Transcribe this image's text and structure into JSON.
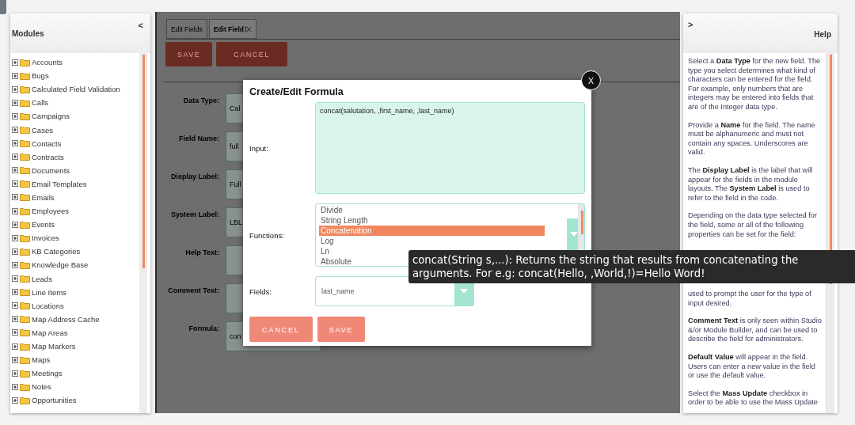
{
  "modules_panel": {
    "title": "Modules",
    "toggle": "<",
    "items": [
      {
        "label": "Accounts",
        "expanded": false
      },
      {
        "label": "Bugs",
        "expanded": false
      },
      {
        "label": "Calculated Field Validation",
        "expanded": false
      },
      {
        "label": "Calls",
        "expanded": false
      },
      {
        "label": "Campaigns",
        "expanded": false
      },
      {
        "label": "Cases",
        "expanded": false
      },
      {
        "label": "Contacts",
        "expanded": false
      },
      {
        "label": "Contracts",
        "expanded": false
      },
      {
        "label": "Documents",
        "expanded": false
      },
      {
        "label": "Email Templates",
        "expanded": false
      },
      {
        "label": "Emails",
        "expanded": false
      },
      {
        "label": "Employees",
        "expanded": false
      },
      {
        "label": "Events",
        "expanded": false
      },
      {
        "label": "Invoices",
        "expanded": false
      },
      {
        "label": "KB Categories",
        "expanded": false
      },
      {
        "label": "Knowledge Base",
        "expanded": false
      },
      {
        "label": "Leads",
        "expanded": false
      },
      {
        "label": "Line Items",
        "expanded": false
      },
      {
        "label": "Locations",
        "expanded": false
      },
      {
        "label": "Map Address Cache",
        "expanded": false
      },
      {
        "label": "Map Areas",
        "expanded": false
      },
      {
        "label": "Map Markers",
        "expanded": false
      },
      {
        "label": "Maps",
        "expanded": false
      },
      {
        "label": "Meetings",
        "expanded": false
      },
      {
        "label": "Notes",
        "expanded": false
      },
      {
        "label": "Opportunities",
        "expanded": false
      }
    ]
  },
  "editor": {
    "tabs": [
      {
        "label": "Edit Fields",
        "selected": false,
        "closable": false
      },
      {
        "label": "Edit Field",
        "selected": true,
        "closable": true
      }
    ],
    "buttons": [
      "SAVE",
      "CANCEL"
    ],
    "form": [
      {
        "label": "Data Type:",
        "value": "Cal"
      },
      {
        "label": "Field Name:",
        "value": "full"
      },
      {
        "label": "Display Label:",
        "value": "Full"
      },
      {
        "label": "System Label:",
        "value": "LBL"
      },
      {
        "label": "Help Text:"
      },
      {
        "label": "Comment Text:"
      },
      {
        "label": "Formula:",
        "value": "con"
      }
    ]
  },
  "dialog": {
    "title": "Create/Edit Formula",
    "close": "X",
    "input": {
      "label": "Input:",
      "value": "concat(salutation, ,first_name, ,last_name)"
    },
    "functions": {
      "label": "Functions:",
      "options": [
        {
          "label": "Divide",
          "selected": false
        },
        {
          "label": "String Length",
          "selected": false
        },
        {
          "label": "Concatenation",
          "selected": true
        },
        {
          "label": "Log",
          "selected": false
        },
        {
          "label": "Ln",
          "selected": false
        },
        {
          "label": "Absolute",
          "selected": false
        }
      ]
    },
    "fields": {
      "label": "Fields:",
      "value": "last_name"
    },
    "buttons": [
      "CANCEL",
      "SAVE"
    ]
  },
  "tooltip": {
    "text": "concat(String s,...): Returns the string that results from concatenating the arguments. For e.g: concat(Hello, ,World,!)=Hello Word!"
  },
  "help_panel": {
    "toggle": ">",
    "title": "Help",
    "paragraphs": [
      "Select a **Data Type** for the new field. The type you select determines what kind of characters can be entered for the field. For example, only numbers that are integers may be entered into fields that are of the Integer data type.",
      "Provide a **Name** for the field. The name must be alphanumeric and must not contain any spaces. Underscores are valid.",
      "The **Display Label** is the label that will appear for the fields in the module layouts. The **System Label** is used to refer to the field in the code.",
      "Depending on the data type selected for the field, some or all of the following properties can be set for the field:",
      "used to prompt the user for the type of input desired.",
      "**Comment Text** is only seen within Studio &/or Module Builder, and can be used to describe the field for administrators.",
      "**Default Value** will appear in the field. Users can enter a new value in the field or use the default value.",
      "Select the **Mass Update** checkbox in order to be able to use the Mass Update"
    ]
  }
}
